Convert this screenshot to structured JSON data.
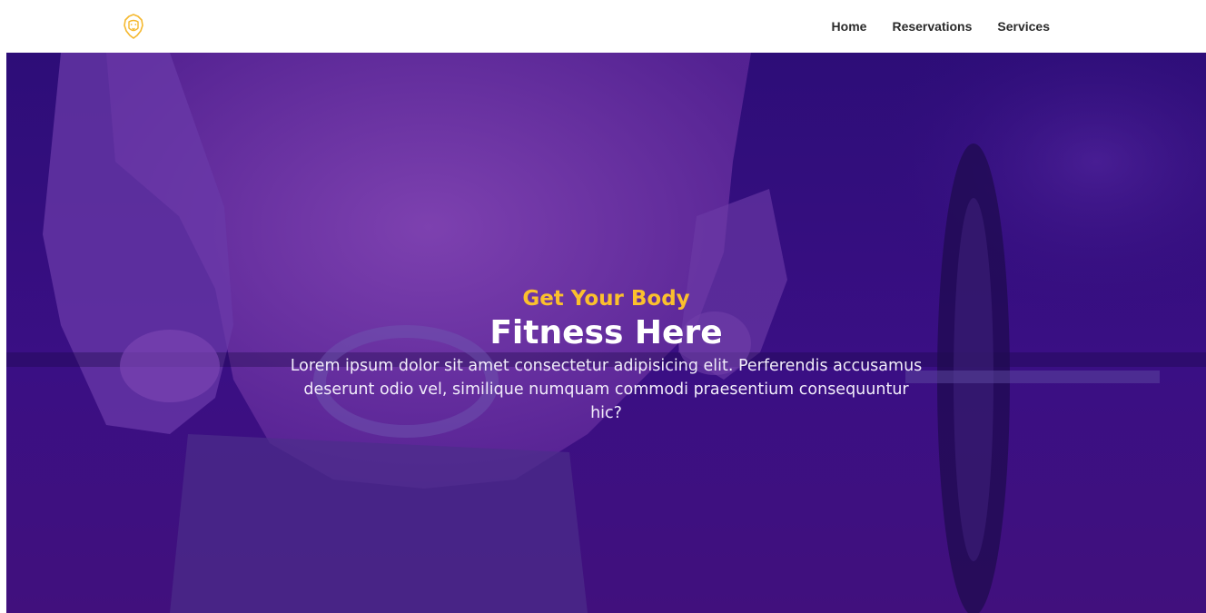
{
  "header": {
    "logo_icon": "lion-head-icon",
    "nav": [
      {
        "label": "Home"
      },
      {
        "label": "Reservations"
      },
      {
        "label": "Services"
      }
    ]
  },
  "hero": {
    "subtitle": "Get Your Body",
    "title": "Fitness Here",
    "description": "Lorem ipsum dolor sit amet consectetur adipisicing elit. Perferendis accusamus deserunt odio vel, similique numquam commodi praesentium consequuntur hic?"
  },
  "colors": {
    "accent": "#fbc02d",
    "overlay": "#3a0f84",
    "nav_text": "#2b2b2b"
  }
}
